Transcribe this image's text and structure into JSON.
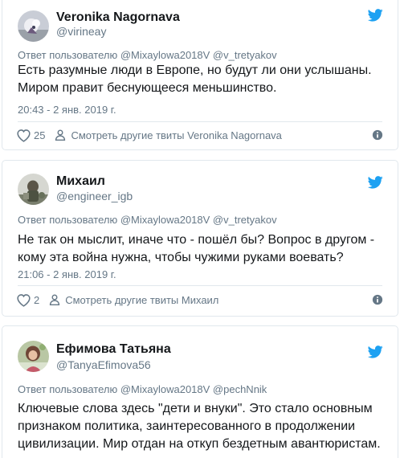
{
  "colors": {
    "text": "#14171a",
    "secondary": "#657786",
    "border": "#e1e8ed",
    "twitter_blue": "#1da1f2"
  },
  "tweets": [
    {
      "author_name": "Veronika Nagornava",
      "author_handle": "@virineay",
      "reply_to": "Ответ пользователю @Mixaylowa2018V @v_tretyakov",
      "text": "Есть разумные люди в Европе, но будут ли они услышаны. Миром правит беснующееся меньшинство.",
      "timestamp": "20:43 - 2 янв. 2019 г.",
      "likes": "25",
      "more_tweets_label": "Смотреть другие твиты Veronika Nagornava",
      "avatar_icon": "avatar-photo",
      "logo_icon": "twitter-bird-icon"
    },
    {
      "author_name": "Михаил",
      "author_handle": "@engineer_igb",
      "reply_to": "Ответ пользователю @Mixaylowa2018V @v_tretyakov",
      "text": "Не так он мыслит, иначе что - пошёл бы? Вопрос в другом - кому эта война нужна, чтобы чужими руками воевать?",
      "timestamp": "21:06 - 2 янв. 2019 г.",
      "likes": "2",
      "more_tweets_label": "Смотреть другие твиты Михаил",
      "avatar_icon": "avatar-photo",
      "logo_icon": "twitter-bird-icon"
    },
    {
      "author_name": "Ефимова Татьяна",
      "author_handle": "@TanyaEfimova56",
      "reply_to": "Ответ пользователю @Mixaylowa2018V @pechNnik",
      "text": "Ключевые слова здесь \"дети и внуки\". Это стало основным признаком политика, заинтересованного в продолжении цивилизации. Мир отдан на откуп бездетным авантюристам.",
      "avatar_icon": "avatar-photo",
      "logo_icon": "twitter-bird-icon"
    }
  ]
}
